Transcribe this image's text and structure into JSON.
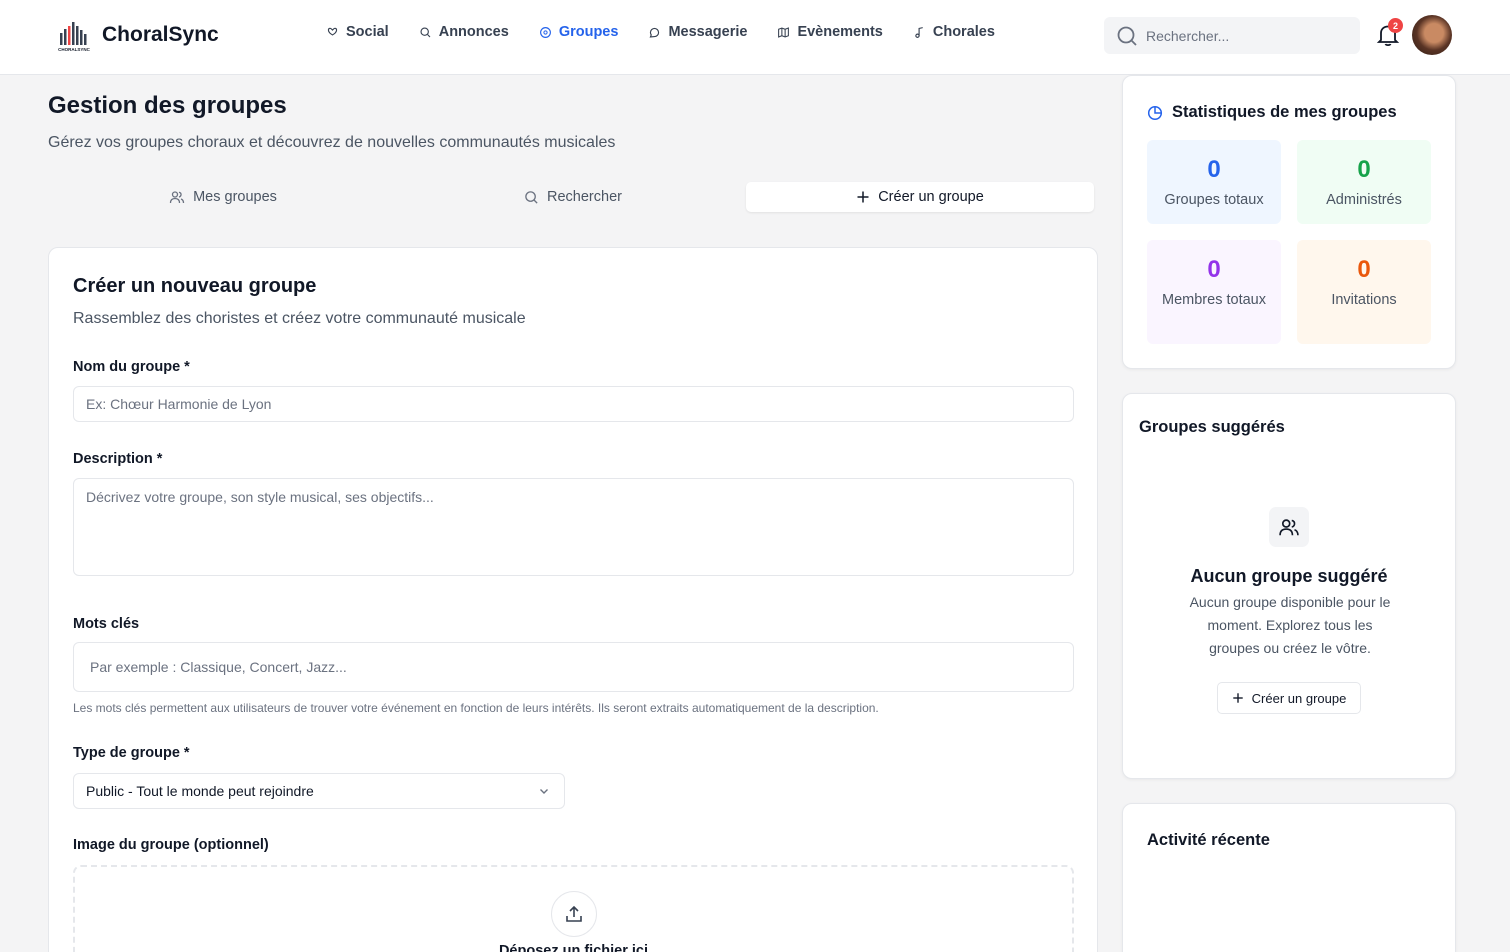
{
  "brand": {
    "name": "ChoralSync",
    "logo_text": "CHORALSYNC"
  },
  "nav": {
    "items": [
      {
        "label": "Social",
        "icon": "heart-hand-icon"
      },
      {
        "label": "Annonces",
        "icon": "search-icon"
      },
      {
        "label": "Groupes",
        "icon": "globe-icon",
        "active": true
      },
      {
        "label": "Messagerie",
        "icon": "chat-icon"
      },
      {
        "label": "Evènements",
        "icon": "map-icon"
      },
      {
        "label": "Chorales",
        "icon": "music-note-icon"
      }
    ]
  },
  "header": {
    "search_placeholder": "Rechercher...",
    "notification_count": "2"
  },
  "page": {
    "title": "Gestion des groupes",
    "subtitle": "Gérez vos groupes choraux et découvrez de nouvelles communautés musicales"
  },
  "tabs": [
    {
      "label": "Mes groupes"
    },
    {
      "label": "Rechercher"
    },
    {
      "label": "Créer un groupe",
      "active": true
    }
  ],
  "form": {
    "title": "Créer un nouveau groupe",
    "subtitle": "Rassemblez des choristes et créez votre communauté musicale",
    "name_label": "Nom du groupe *",
    "name_placeholder": "Ex: Chœur Harmonie de Lyon",
    "description_label": "Description *",
    "description_placeholder": "Décrivez votre groupe, son style musical, ses objectifs...",
    "keywords_label": "Mots clés",
    "keywords_placeholder": "Par exemple : Classique, Concert, Jazz...",
    "keywords_hint": "Les mots clés permettent aux utilisateurs de trouver votre événement en fonction de leurs intérêts. Ils seront extraits automatiquement de la description.",
    "type_label": "Type de groupe *",
    "type_value": "Public - Tout le monde peut rejoindre",
    "image_label": "Image du groupe (optionnel)",
    "drop_text": "Déposez un fichier ici"
  },
  "stats": {
    "title": "Statistiques de mes groupes",
    "items": [
      {
        "value": "0",
        "label": "Groupes totaux",
        "color": "#2563eb",
        "bg": "#eff6ff"
      },
      {
        "value": "0",
        "label": "Administrés",
        "color": "#16a34a",
        "bg": "#f0fdf4"
      },
      {
        "value": "0",
        "label": "Membres totaux",
        "color": "#9333ea",
        "bg": "#faf5ff"
      },
      {
        "value": "0",
        "label": "Invitations",
        "color": "#ea580c",
        "bg": "#fff7ed"
      }
    ]
  },
  "suggested": {
    "title": "Groupes suggérés",
    "empty_title": "Aucun groupe suggéré",
    "empty_text": "Aucun groupe disponible pour le moment. Explorez tous les groupes ou créez le vôtre.",
    "button_label": "Créer un groupe"
  },
  "activity": {
    "title": "Activité récente"
  }
}
